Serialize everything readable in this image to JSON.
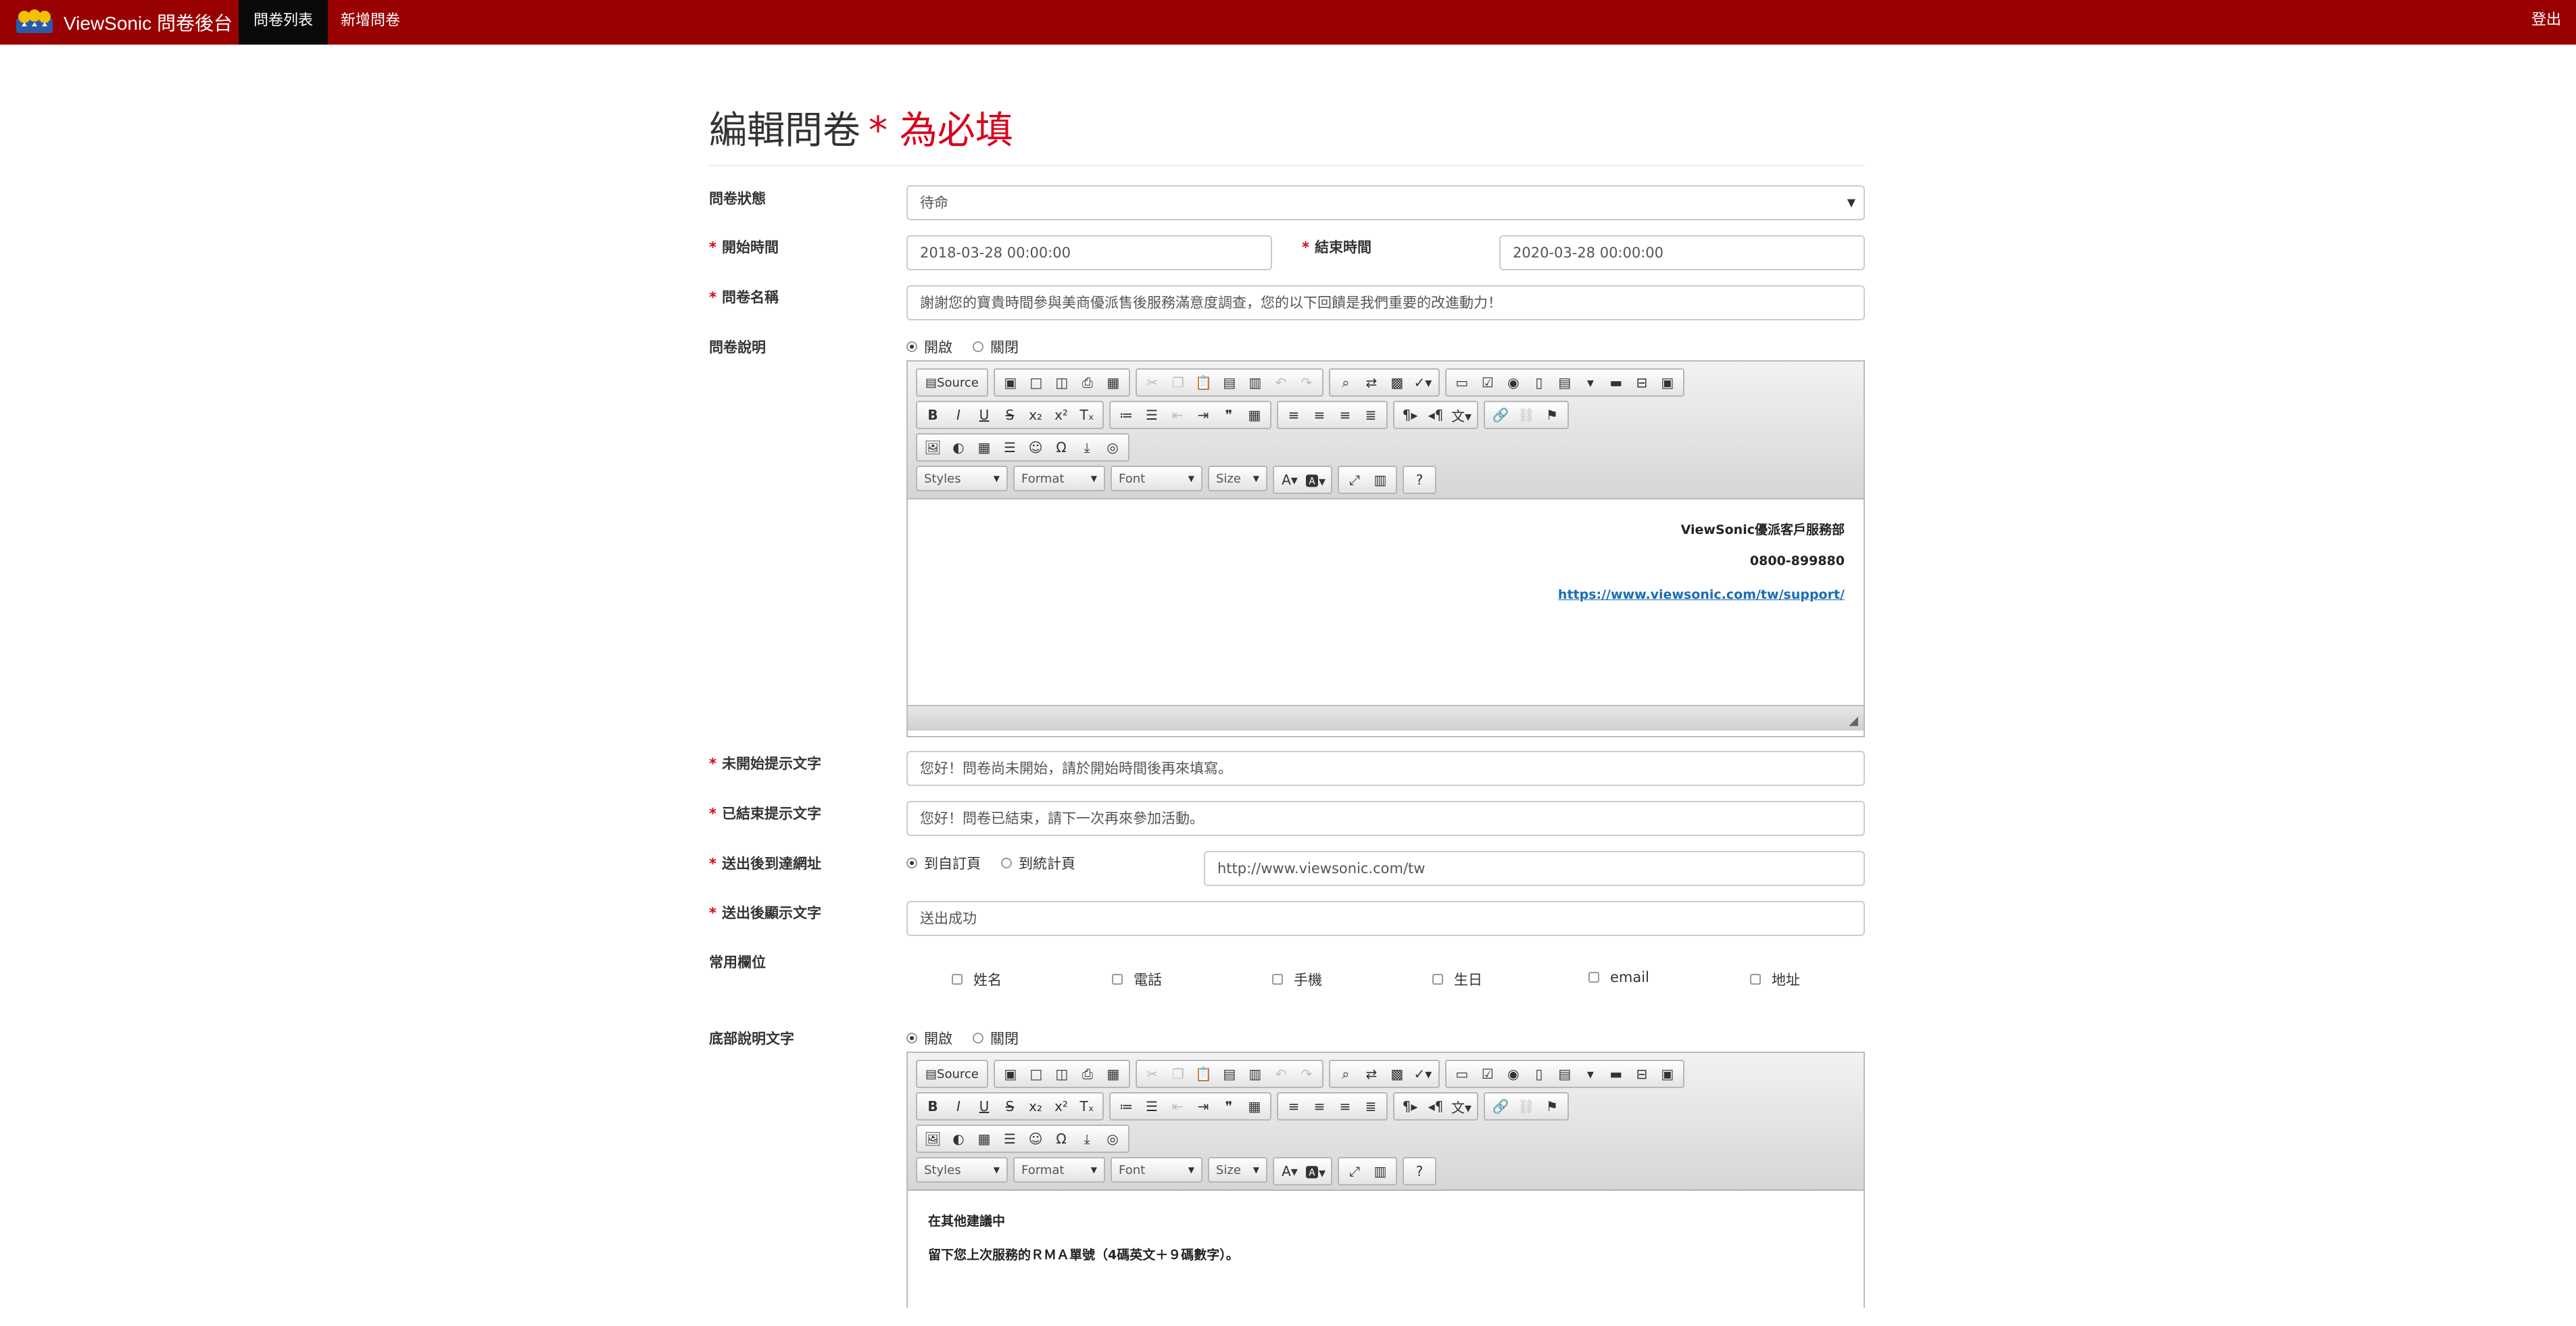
{
  "navbar": {
    "brand": "ViewSonic 問卷後台",
    "tabs": [
      {
        "label": "問卷列表",
        "active": true
      },
      {
        "label": "新增問卷",
        "active": false
      }
    ],
    "logout": "登出",
    "bg_color": "#990000"
  },
  "page": {
    "title": "編輯問卷",
    "required_note": "* 為必填"
  },
  "form": {
    "status": {
      "label": "問卷狀態",
      "value": "待命"
    },
    "start_time": {
      "label": "開始時間",
      "value": "2018-03-28 00:00:00"
    },
    "end_time": {
      "label": "結束時間",
      "value": "2020-03-28 00:00:00"
    },
    "name": {
      "label": "問卷名稱",
      "value": "謝謝您的寶貴時間參與美商優派售後服務滿意度調查，您的以下回饋是我們重要的改進動力！"
    },
    "description": {
      "label": "問卷說明",
      "radio_on": "開啟",
      "radio_off": "關閉",
      "content": {
        "line1": "ViewSonic優派客戶服務部",
        "line2": "0800-899880",
        "line3": "https://www.viewsonic.com/tw/support/"
      }
    },
    "not_started_text": {
      "label": "未開始提示文字",
      "value": "您好！問卷尚未開始，請於開始時間後再來填寫。"
    },
    "ended_text": {
      "label": "已結束提示文字",
      "value": "您好！問卷已結束，請下一次再來參加活動。"
    },
    "redirect": {
      "label": "送出後到達網址",
      "option1": "到自訂頁",
      "option2": "到統計頁",
      "url": "http://www.viewsonic.com/tw"
    },
    "submit_text": {
      "label": "送出後顯示文字",
      "value": "送出成功"
    },
    "common_fields": {
      "label": "常用欄位",
      "items": [
        "姓名",
        "電話",
        "手機",
        "生日",
        "email",
        "地址"
      ]
    },
    "footer_text": {
      "label": "底部說明文字",
      "radio_on": "開啟",
      "radio_off": "關閉",
      "content": {
        "line1": "在其他建議中",
        "line2": "留下您上次服務的ＲＭＡ單號（4碼英文＋９碼數字）。"
      }
    }
  },
  "editor_toolbar": {
    "source": "Source",
    "styles": "Styles",
    "format": "Format",
    "font": "Font",
    "size": "Size"
  }
}
